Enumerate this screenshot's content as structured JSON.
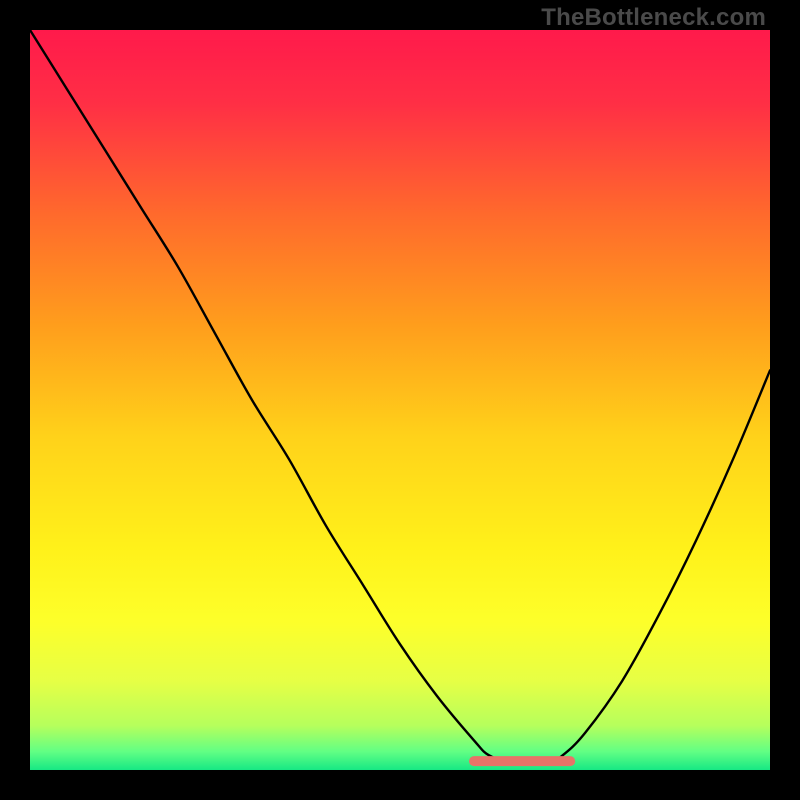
{
  "watermark": "TheBottleneck.com",
  "colors": {
    "frame": "#000000",
    "curve": "#000000",
    "marker": "#e87368",
    "gradient_stops": [
      {
        "offset": 0.0,
        "color": "#ff1a4b"
      },
      {
        "offset": 0.1,
        "color": "#ff2f45"
      },
      {
        "offset": 0.25,
        "color": "#ff6a2c"
      },
      {
        "offset": 0.4,
        "color": "#ff9e1c"
      },
      {
        "offset": 0.55,
        "color": "#ffd21a"
      },
      {
        "offset": 0.7,
        "color": "#fff11a"
      },
      {
        "offset": 0.8,
        "color": "#fdff2a"
      },
      {
        "offset": 0.88,
        "color": "#e6ff45"
      },
      {
        "offset": 0.94,
        "color": "#b6ff5c"
      },
      {
        "offset": 0.975,
        "color": "#62ff84"
      },
      {
        "offset": 1.0,
        "color": "#17e884"
      }
    ]
  },
  "chart_data": {
    "type": "line",
    "title": "",
    "xlabel": "",
    "ylabel": "",
    "xlim": [
      0,
      100
    ],
    "ylim": [
      0,
      100
    ],
    "grid": false,
    "legend": false,
    "series": [
      {
        "name": "bottleneck-curve",
        "x": [
          0,
          5,
          10,
          15,
          20,
          25,
          30,
          35,
          40,
          45,
          50,
          55,
          60,
          62,
          65,
          70,
          72,
          75,
          80,
          85,
          90,
          95,
          100
        ],
        "y": [
          100,
          92,
          84,
          76,
          68,
          59,
          50,
          42,
          33,
          25,
          17,
          10,
          4,
          2,
          1,
          1,
          2,
          5,
          12,
          21,
          31,
          42,
          54
        ]
      }
    ],
    "flat_segment": {
      "x_start": 60,
      "x_end": 73,
      "y": 1.2
    }
  }
}
